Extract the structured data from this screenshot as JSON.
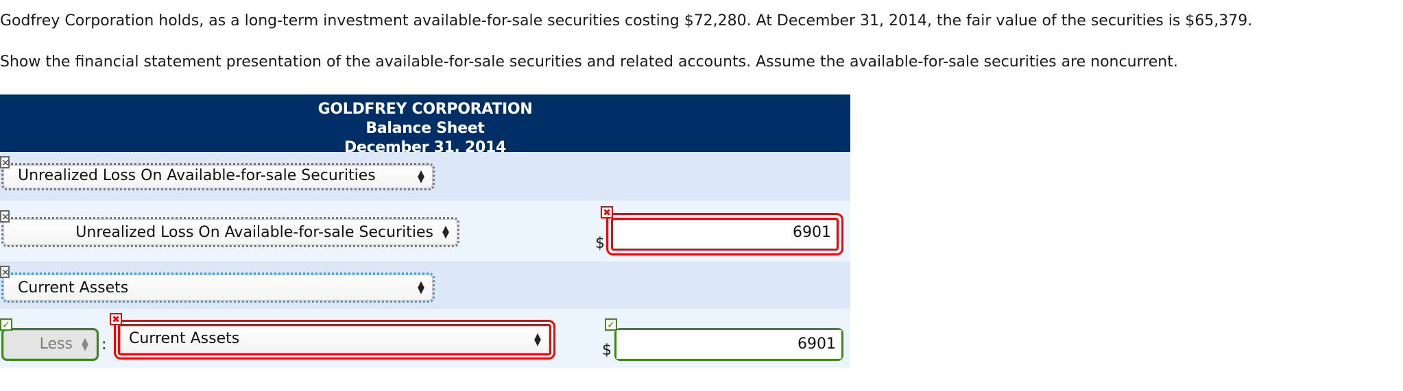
{
  "prompt": {
    "line1": "Godfrey Corporation holds, as a long-term investment available-for-sale securities costing $72,280. At December 31, 2014, the fair value of the securities is $65,379.",
    "line2": "Show the financial statement presentation of the available-for-sale securities and related accounts. Assume the available-for-sale securities are noncurrent."
  },
  "sheet": {
    "company": "GOLDFREY CORPORATION",
    "statement": "Balance Sheet",
    "date": "December 31, 2014"
  },
  "rows": [
    {
      "status": "neutral",
      "select_value": "Unrealized Loss On Available-for-sale Securities"
    },
    {
      "status": "neutral",
      "select_value": "Unrealized Loss On Available-for-sale Securities",
      "currency": "$",
      "amount": "6901",
      "amount_status": "incorrect"
    },
    {
      "status": "neutral",
      "select_value": "Current Assets"
    },
    {
      "status": "correct",
      "modifier_value": "Less",
      "separator": ":",
      "select_status": "incorrect",
      "select_value": "Current Assets",
      "currency": "$",
      "amount": "6901",
      "amount_status": "correct"
    }
  ],
  "icons": {
    "neutral": "×",
    "incorrect": "✖",
    "correct": "✓",
    "select_arrows": "▲▼"
  },
  "colors": {
    "header_bg": "#002e66",
    "row_dark": "#dce8f7",
    "row_light": "#ecf4fd",
    "incorrect": "#ff0000",
    "correct": "#3a8a12",
    "focus": "#4a90e2"
  }
}
